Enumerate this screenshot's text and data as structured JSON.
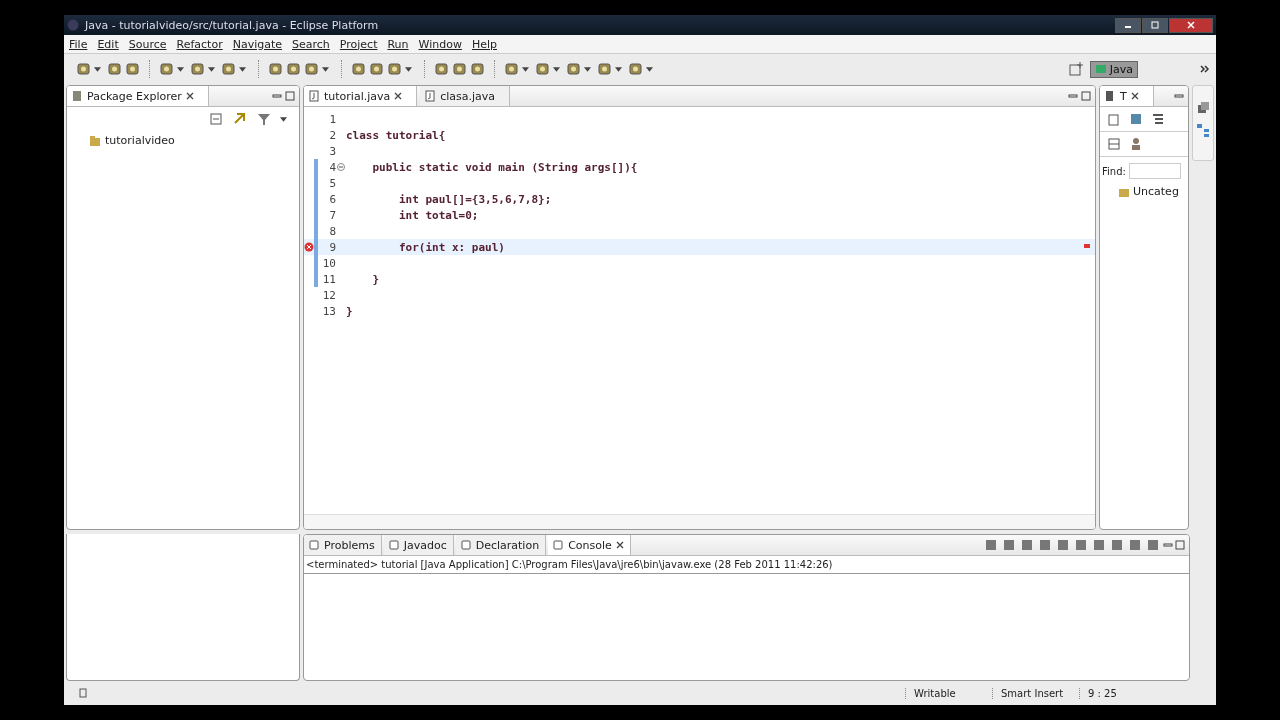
{
  "window": {
    "title": "Java - tutorialvideo/src/tutorial.java - Eclipse Platform"
  },
  "menu": [
    "File",
    "Edit",
    "Source",
    "Refactor",
    "Navigate",
    "Search",
    "Project",
    "Run",
    "Window",
    "Help"
  ],
  "perspective": {
    "label": "Java",
    "selected": true
  },
  "package_explorer": {
    "title": "Package Explorer",
    "items": [
      {
        "label": "tutorialvideo",
        "selected": false
      }
    ]
  },
  "editor": {
    "tabs": [
      {
        "label": "tutorial.java",
        "selected": true
      },
      {
        "label": "clasa.java",
        "selected": false
      }
    ],
    "lines": [
      {
        "number": "1",
        "range": false,
        "fold": false,
        "error": false,
        "current": false
      },
      {
        "number": "2",
        "text": "class tutorial{",
        "range": false,
        "fold": false,
        "error": false,
        "current": false
      },
      {
        "number": "3",
        "range": false,
        "fold": false,
        "error": false,
        "current": false
      },
      {
        "number": "4",
        "text": "    public static void main (String args[]){",
        "range": true,
        "fold": true,
        "error": false,
        "current": false
      },
      {
        "number": "5",
        "range": true,
        "fold": false,
        "error": false,
        "current": false
      },
      {
        "number": "6",
        "text": "        int paul[]={3,5,6,7,8};",
        "range": true,
        "fold": false,
        "error": false,
        "current": false
      },
      {
        "number": "7",
        "text": "        int total=0;",
        "range": true,
        "fold": false,
        "error": false,
        "current": false
      },
      {
        "number": "8",
        "range": true,
        "fold": false,
        "error": false,
        "current": false
      },
      {
        "number": "9",
        "text": "        for(int x: paul)",
        "range": true,
        "fold": false,
        "error": true,
        "current": true
      },
      {
        "number": "10",
        "range": true,
        "fold": false,
        "error": false,
        "current": false
      },
      {
        "number": "11",
        "text": "    }",
        "range": true,
        "fold": false,
        "error": false,
        "current": false
      },
      {
        "number": "12",
        "range": false,
        "fold": false,
        "error": false,
        "current": false
      },
      {
        "number": "13",
        "text": "}",
        "range": false,
        "fold": false,
        "error": false,
        "current": false
      }
    ]
  },
  "outline": {
    "tab": "T",
    "find_label": "Find:",
    "items": [
      {
        "label": "Uncateg"
      }
    ]
  },
  "console": {
    "tabs": [
      {
        "label": "Problems",
        "selected": false
      },
      {
        "label": "Javadoc",
        "selected": false
      },
      {
        "label": "Declaration",
        "selected": false
      },
      {
        "label": "Console",
        "selected": true
      }
    ],
    "status": "<terminated> tutorial [Java Application] C:\\Program Files\\Java\\jre6\\bin\\javaw.exe (28 Feb 2011 11:42:26)"
  },
  "status_bar": [
    "Writable",
    "Smart Insert",
    "9 : 25"
  ]
}
